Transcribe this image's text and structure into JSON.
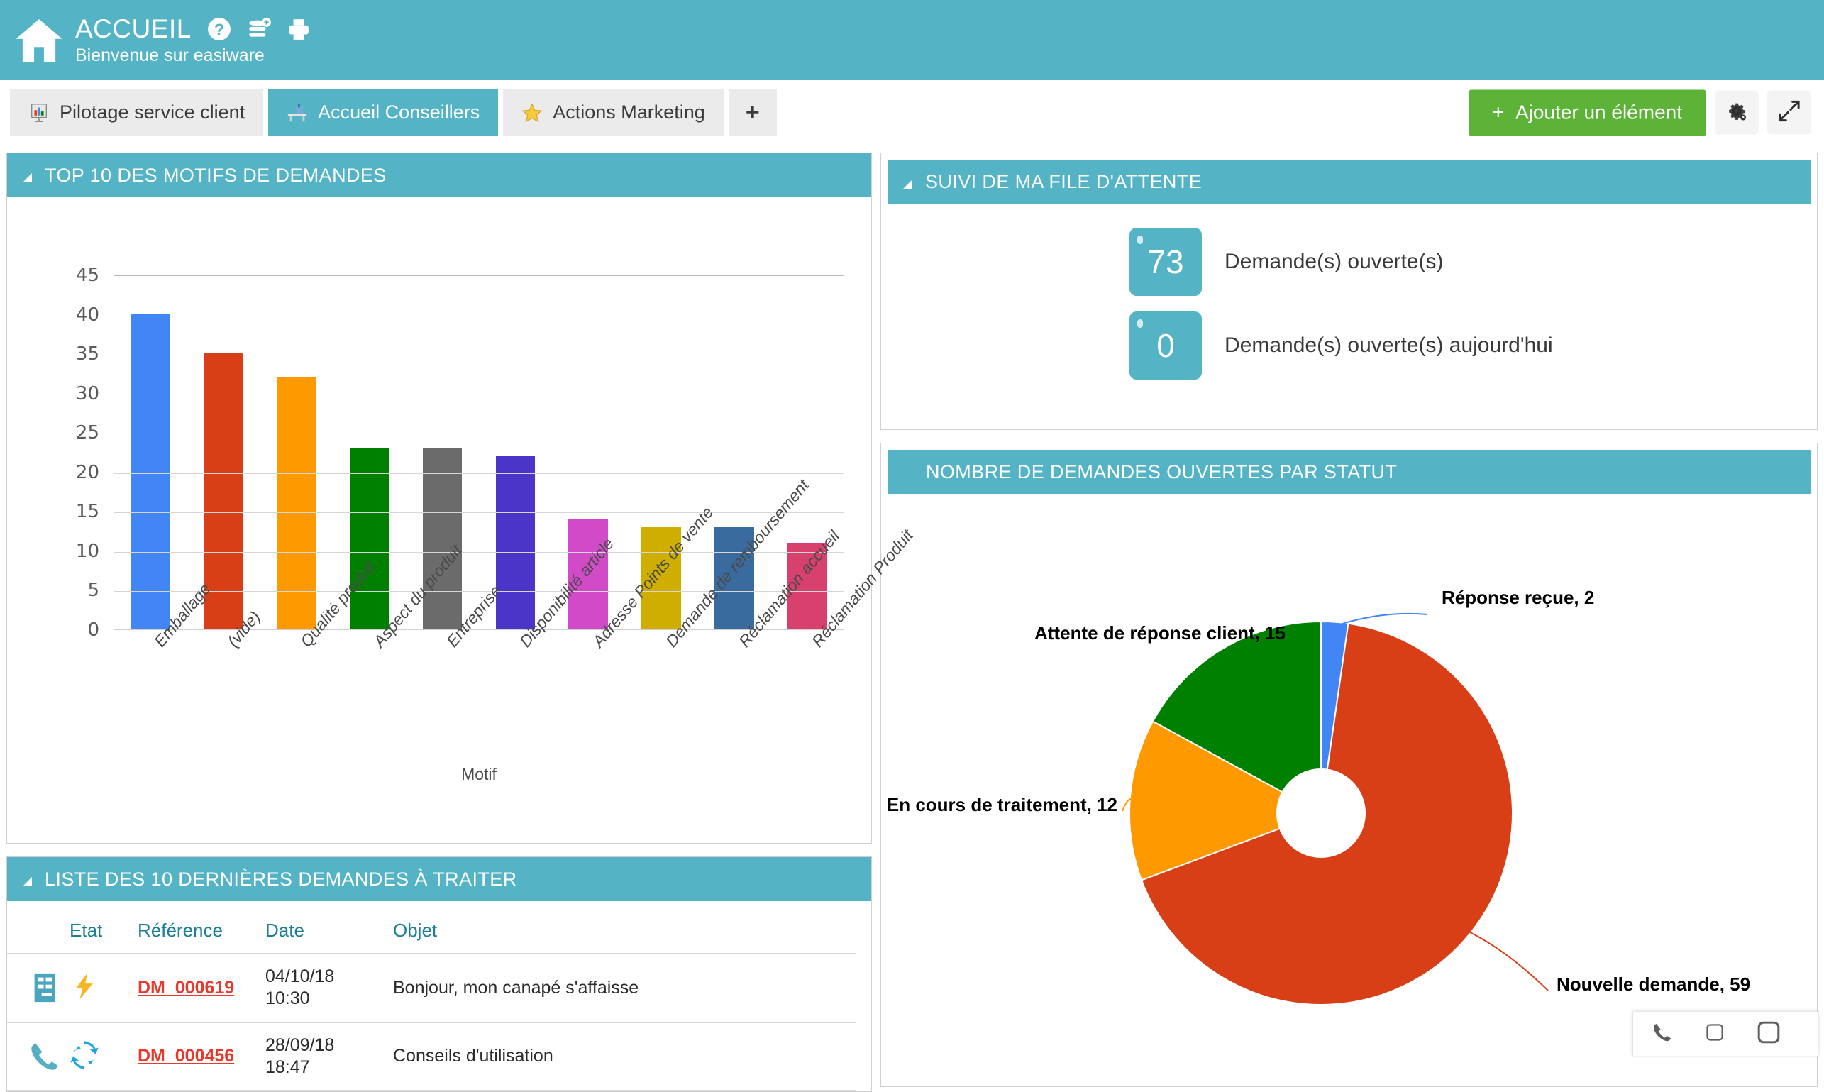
{
  "header": {
    "home_icon": "home-icon",
    "title": "ACCUEIL",
    "subtitle": "Bienvenue sur easiware",
    "icons": [
      {
        "name": "help-icon",
        "label": "?"
      },
      {
        "name": "add-record-icon",
        "label": "+"
      },
      {
        "name": "print-icon",
        "label": "print"
      }
    ],
    "brand_color": "#54b4c6"
  },
  "tabs": [
    {
      "label": "Pilotage service client",
      "icon": "chart-board-icon",
      "active": false
    },
    {
      "label": "Accueil Conseillers",
      "icon": "desk-icon",
      "active": true
    },
    {
      "label": "Actions Marketing",
      "icon": "star-icon",
      "active": false
    }
  ],
  "tab_add": {
    "label": "+",
    "name": "add-tab-button"
  },
  "toolbar": {
    "add_label": "Ajouter un élément",
    "add_plus": "+",
    "add_color": "#5cb338",
    "settings_icon": "gear-icon",
    "expand_icon": "expand-arrows-icon"
  },
  "panels": {
    "bar": {
      "title": "TOP 10 DES MOTIFS DE DEMANDES"
    },
    "queue": {
      "title": "SUIVI DE MA FILE D'ATTENTE"
    },
    "donut": {
      "title": "NOMBRE DE DEMANDES OUVERTES PAR STATUT"
    },
    "table": {
      "title": "LISTE DES 10 DERNIÈRES DEMANDES À TRAITER"
    }
  },
  "queue": {
    "rows": [
      {
        "value": "73",
        "label": "Demande(s) ouverte(s)"
      },
      {
        "value": "0",
        "label": "Demande(s) ouverte(s) aujourd'hui"
      }
    ]
  },
  "table": {
    "columns": [
      "",
      "Etat",
      "Référence",
      "Date",
      "Objet"
    ],
    "rows": [
      {
        "channel_icon": "form-icon",
        "etat_icon": "lightning-icon",
        "reference": "DM_000619",
        "date": "04/10/18",
        "time": "10:30",
        "objet": "Bonjour, mon canapé s'affaisse"
      },
      {
        "channel_icon": "phone-icon",
        "etat_icon": "refresh-icon",
        "reference": "DM_000456",
        "date": "28/09/18",
        "time": "18:47",
        "objet": "Conseils d'utilisation"
      }
    ]
  },
  "floatbar": {
    "icons": [
      {
        "name": "phone-icon"
      },
      {
        "name": "small-square-icon"
      },
      {
        "name": "large-square-icon"
      }
    ]
  },
  "chart_data": [
    {
      "type": "bar",
      "title": "TOP 10 DES MOTIFS DE DEMANDES",
      "xlabel": "Motif",
      "ylabel": "",
      "ylim": [
        0,
        45
      ],
      "yticks": [
        0,
        5,
        10,
        15,
        20,
        25,
        30,
        35,
        40,
        45
      ],
      "grid": true,
      "legend": "none",
      "categories": [
        "Emballage",
        "(vide)",
        "Qualité produit",
        "Aspect du produit",
        "Entreprise",
        "Disponibilité article",
        "Adresse Points de vente",
        "Demande de remboursement",
        "Réclamation accueil",
        "Réclamation Produit"
      ],
      "values": [
        40,
        35,
        32,
        23,
        23,
        22,
        14,
        13,
        13,
        11
      ],
      "colors": [
        "#4285f4",
        "#d93f17",
        "#ff9900",
        "#008000",
        "#6b6b6b",
        "#4b35c9",
        "#d14bc8",
        "#cfae00",
        "#3a6b9e",
        "#d8416e"
      ]
    },
    {
      "type": "pie",
      "title": "NOMBRE DE DEMANDES OUVERTES PAR STATUT",
      "donut": true,
      "labels": [
        "Nouvelle demande",
        "Attente de réponse client",
        "En cours de traitement",
        "Réponse reçue"
      ],
      "values": [
        59,
        15,
        12,
        2
      ],
      "colors": [
        "#d93f17",
        "#008000",
        "#ff9900",
        "#4285f4"
      ],
      "annotations": [
        "Réponse reçue, 2",
        "Attente de réponse client, 15",
        "En cours de traitement, 12",
        "Nouvelle demande, 59"
      ]
    }
  ]
}
